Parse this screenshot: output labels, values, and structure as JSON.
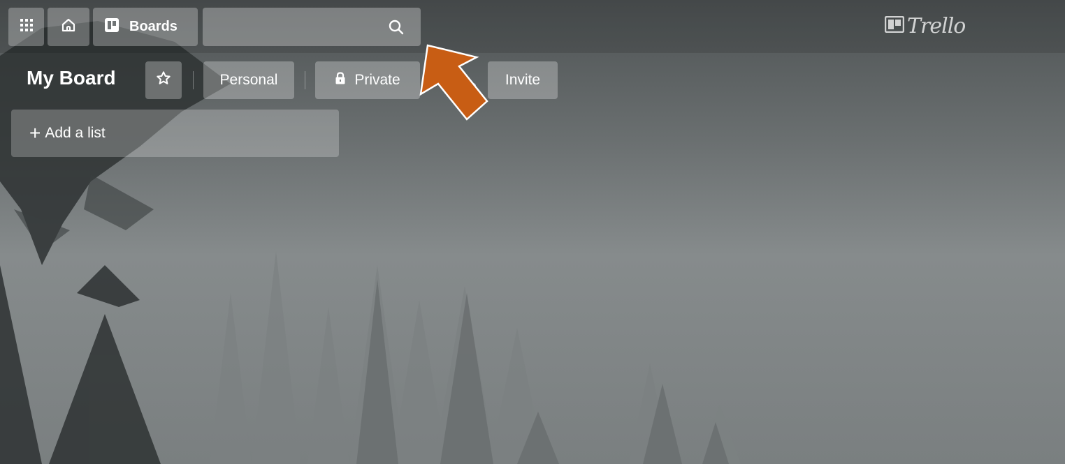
{
  "header": {
    "boards_label": "Boards",
    "search_placeholder": "",
    "logo_text": "Trello"
  },
  "board": {
    "title": "My Board",
    "team_label": "Personal",
    "visibility_label": "Private",
    "invite_label": "Invite"
  },
  "lists": {
    "add_list_label": "Add a list"
  },
  "icons": {
    "apps": "apps-grid-icon",
    "home": "home-icon",
    "boards": "boards-icon",
    "search": "search-icon",
    "logo": "trello-logo-icon",
    "star": "star-icon",
    "lock": "lock-icon",
    "members": "members-icon",
    "plus": "plus-icon",
    "annotation": "annotation-arrow"
  },
  "colors": {
    "annotation_arrow": "#c85d14",
    "button_overlay": "rgba(255,255,255,0.28)"
  }
}
